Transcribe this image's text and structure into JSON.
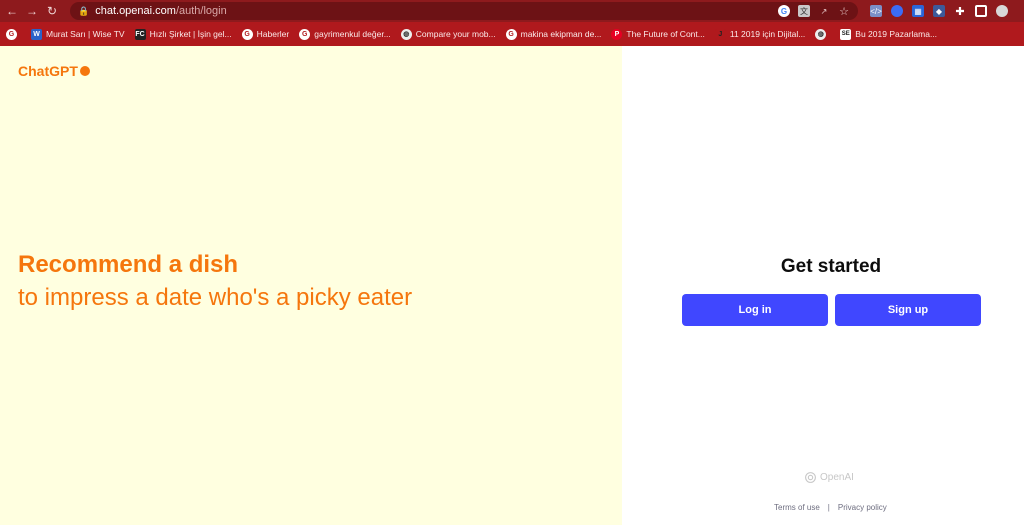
{
  "browser": {
    "url_host": "chat.openai.com",
    "url_path": "/auth/login",
    "bookmarks": [
      {
        "icon": "google-icon",
        "label": ""
      },
      {
        "icon": "W",
        "label": "Murat Sarı | Wise TV"
      },
      {
        "icon": "FC",
        "label": "Hızlı Şirket | İşin gel..."
      },
      {
        "icon": "google-icon",
        "label": "Haberler"
      },
      {
        "icon": "google-icon",
        "label": "gayrimenkul değer..."
      },
      {
        "icon": "globe-icon",
        "label": "Compare your mob..."
      },
      {
        "icon": "google-icon",
        "label": "makina ekipman de..."
      },
      {
        "icon": "pinterest-icon",
        "label": "The Future of Cont..."
      },
      {
        "icon": "J",
        "label": "11 2019 için Dijital..."
      },
      {
        "icon": "globe-icon",
        "label": ""
      },
      {
        "icon": "SE",
        "label": "Bu 2019 Pazarlama..."
      }
    ]
  },
  "left": {
    "brand": "ChatGPT",
    "headline": "Recommend a dish",
    "subline": "to impress a date who's a picky eater"
  },
  "right": {
    "title": "Get started",
    "login_label": "Log in",
    "signup_label": "Sign up",
    "openai_label": "OpenAI",
    "terms_label": "Terms of use",
    "separator": "|",
    "privacy_label": "Privacy policy"
  },
  "colors": {
    "accent_orange": "#f5760d",
    "button_blue": "#4047ff",
    "left_bg": "#ffffe0",
    "chrome_red": "#8e1a1d"
  }
}
